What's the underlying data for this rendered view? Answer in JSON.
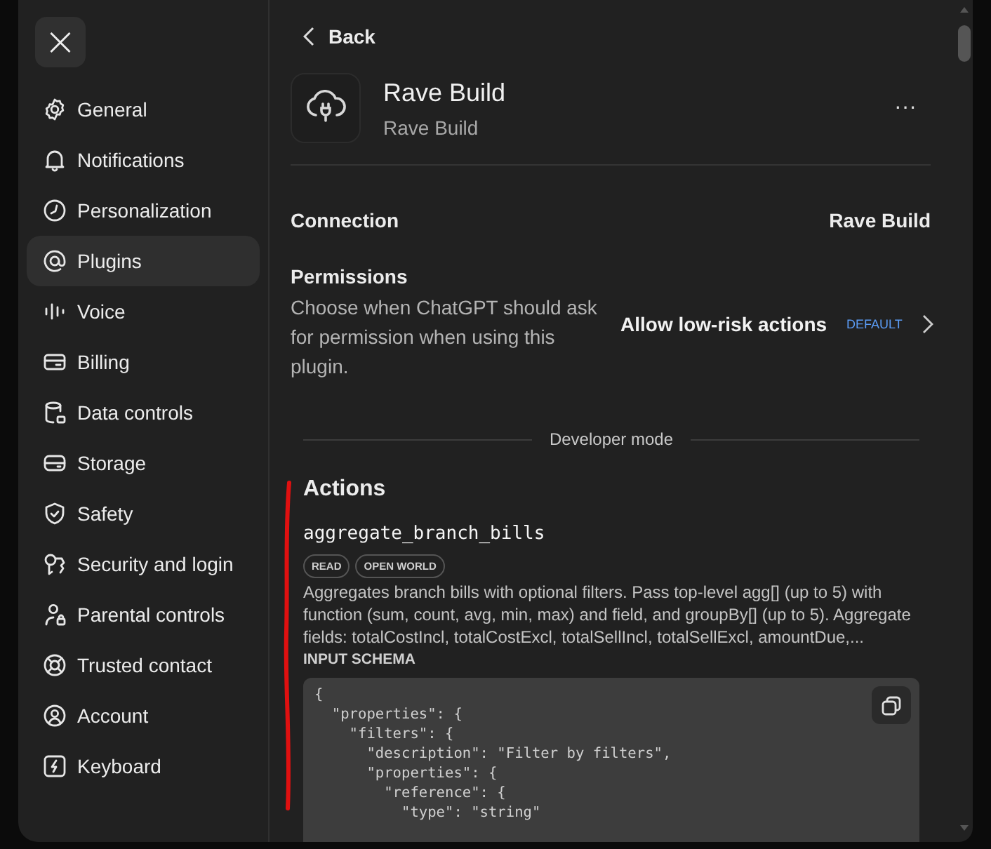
{
  "sidebar": {
    "close": "×",
    "items": [
      {
        "label": "General",
        "selected": false
      },
      {
        "label": "Notifications",
        "selected": false
      },
      {
        "label": "Personalization",
        "selected": false
      },
      {
        "label": "Plugins",
        "selected": true
      },
      {
        "label": "Voice",
        "selected": false
      },
      {
        "label": "Billing",
        "selected": false
      },
      {
        "label": "Data controls",
        "selected": false
      },
      {
        "label": "Storage",
        "selected": false
      },
      {
        "label": "Safety",
        "selected": false
      },
      {
        "label": "Security and login",
        "selected": false
      },
      {
        "label": "Parental controls",
        "selected": false
      },
      {
        "label": "Trusted contact",
        "selected": false
      },
      {
        "label": "Account",
        "selected": false
      },
      {
        "label": "Keyboard",
        "selected": false
      }
    ]
  },
  "main": {
    "back": "Back",
    "plugin": {
      "title": "Rave Build",
      "subtitle": "Rave Build",
      "more": "···"
    },
    "connection": {
      "label": "Connection",
      "value": "Rave Build"
    },
    "permissions": {
      "label": "Permissions",
      "description": "Choose when ChatGPT should ask for permission when using this plugin.",
      "value": "Allow low-risk actions",
      "badge": "DEFAULT"
    },
    "divider": "Developer mode",
    "actions": {
      "heading": "Actions",
      "items": [
        {
          "name": "aggregate_branch_bills",
          "tags": [
            "READ",
            "OPEN WORLD"
          ],
          "description": "Aggregates branch bills with optional filters. Pass top-level agg[] (up to 5) with function (sum, count, avg, min, max) and field, and groupBy[] (up to 5). Aggregate fields: totalCostIncl, totalCostExcl, totalSellIncl, totalSellExcl, amountDue,...",
          "schema_label": "INPUT SCHEMA",
          "schema_lines": [
            "{",
            "  \"properties\": {",
            "    \"filters\": {",
            "      \"description\": \"Filter by filters\",",
            "      \"properties\": {",
            "        \"reference\": {",
            "          \"type\": \"string\""
          ]
        }
      ]
    }
  },
  "annotation": {
    "kind": "red-line"
  }
}
